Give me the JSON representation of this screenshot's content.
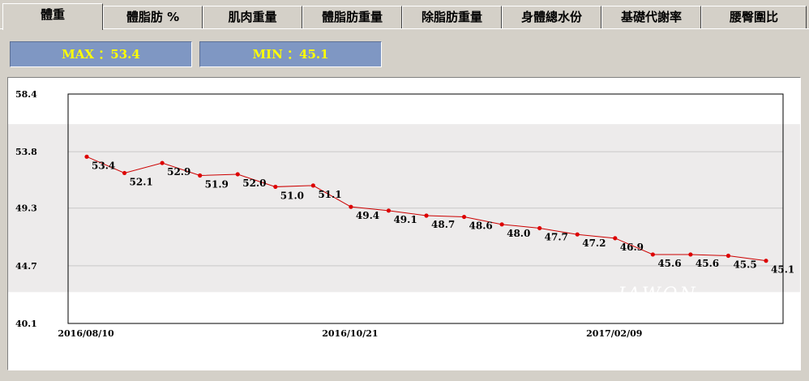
{
  "tabs": [
    {
      "key": "weight",
      "label": "體重"
    },
    {
      "key": "body_fat_pct",
      "label": "體脂肪 %"
    },
    {
      "key": "muscle",
      "label": "肌肉重量"
    },
    {
      "key": "fat_mass",
      "label": "體脂肪重量"
    },
    {
      "key": "lean_mass",
      "label": "除脂肪重量"
    },
    {
      "key": "water",
      "label": "身體總水份"
    },
    {
      "key": "bmr",
      "label": "基礎代謝率"
    },
    {
      "key": "whr",
      "label": "腰臀圍比"
    }
  ],
  "active_tab": "weight",
  "stats": {
    "max_label": "MAX ：53.4",
    "min_label": "MIN ：45.1"
  },
  "watermark": "JAWON",
  "colors": {
    "line": "#cc0000",
    "marker": "#dd0000",
    "band": "#edebeb",
    "stat_bg": "#7f97c3",
    "stat_text": "#ffff00"
  },
  "chart_data": {
    "type": "line",
    "ylim": [
      40.1,
      58.4
    ],
    "yticks": [
      "58.4",
      "53.8",
      "49.3",
      "44.7",
      "40.1"
    ],
    "x_tick_labels": [
      "2016/08/10",
      "2016/10/21",
      "2017/02/09"
    ],
    "normal_range": [
      42.6,
      56.0
    ],
    "series": [
      {
        "values": [
          53.4,
          52.1,
          52.9,
          51.9,
          52.0,
          51.0,
          51.1,
          49.4,
          49.1,
          48.7,
          48.6,
          48.0,
          47.7,
          47.2,
          46.9,
          45.6,
          45.6,
          45.5,
          45.1
        ]
      }
    ]
  }
}
